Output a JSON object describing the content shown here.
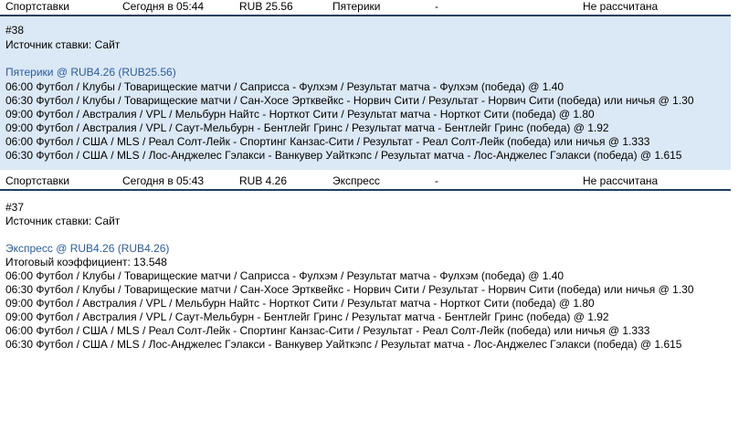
{
  "bets": [
    {
      "header": {
        "bookmaker": "Спортставки",
        "time": "Сегодня в 05:44",
        "amount": "RUB 25.56",
        "type": "Пятерики",
        "dash": "-",
        "status": "Не рассчитана"
      },
      "number": "#38",
      "source": "Источник ставки: Сайт",
      "title": "Пятерики @ RUB4.26 (RUB25.56)",
      "total_coefficient": "",
      "events": [
        "06:00 Футбол / Клубы / Товарищеские матчи / Саприсса - Фулхэм / Результат матча - Фулхэм (победа) @ 1.40",
        "06:30 Футбол / Клубы / Товарищеские матчи / Сан-Хосе Эртквейкс - Норвич Сити / Результат - Норвич Сити (победа) или ничья @ 1.30",
        "09:00 Футбол / Австралия / VPL / Мельбурн Найтс - Норткот Сити / Результат матча - Норткот Сити (победа) @ 1.80",
        "09:00 Футбол / Австралия / VPL / Саут-Мельбурн - Бентлейг Гринс / Результат матча - Бентлейг Гринс (победа) @ 1.92",
        "06:00 Футбол / США / MLS / Реал Солт-Лейк - Спортинг Канзас-Сити / Результат - Реал Солт-Лейк (победа) или ничья @ 1.333",
        "06:30 Футбол / США / MLS / Лос-Анджелес Гэлакси - Ванкувер Уайткэпс / Результат матча - Лос-Анджелес Гэлакси (победа) @ 1.615"
      ]
    },
    {
      "header": {
        "bookmaker": "Спортставки",
        "time": "Сегодня в 05:43",
        "amount": "RUB 4.26",
        "type": "Экспресс",
        "dash": "-",
        "status": "Не рассчитана"
      },
      "number": "#37",
      "source": "Источник ставки: Сайт",
      "title": "Экспресс @ RUB4.26 (RUB4.26)",
      "total_coefficient": "Итоговый коэффициент: 13.548",
      "events": [
        "06:00 Футбол / Клубы / Товарищеские матчи / Саприсса - Фулхэм / Результат матча - Фулхэм (победа) @ 1.40",
        "06:30 Футбол / Клубы / Товарищеские матчи / Сан-Хосе Эртквейкс - Норвич Сити / Результат - Норвич Сити (победа) или ничья @ 1.30",
        "09:00 Футбол / Австралия / VPL / Мельбурн Найтс - Норткот Сити / Результат матча - Норткот Сити (победа) @ 1.80",
        "09:00 Футбол / Австралия / VPL / Саут-Мельбурн - Бентлейг Гринс / Результат матча - Бентлейг Гринс (победа) @ 1.92",
        "06:00 Футбол / США / MLS / Реал Солт-Лейк - Спортинг Канзас-Сити / Результат - Реал Солт-Лейк (победа) или ничья @ 1.333",
        "06:30 Футбол / США / MLS / Лос-Анджелес Гэлакси - Ванкувер Уайткэпс / Результат матча - Лос-Анджелес Гэлакси (победа) @ 1.615"
      ]
    }
  ]
}
